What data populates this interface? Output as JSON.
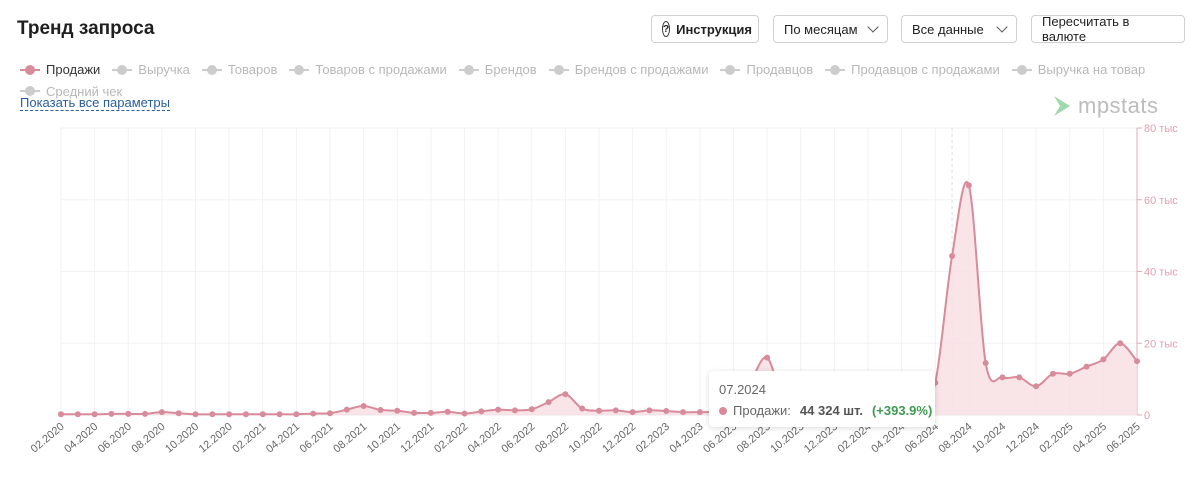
{
  "header": {
    "title": "Тренд запроса",
    "instruction_label": "Инструкция",
    "period_select": "По месяцам",
    "data_select": "Все данные",
    "currency_button": "Пересчитать в валюте"
  },
  "legend": {
    "items": [
      {
        "label": "Продажи",
        "active": true
      },
      {
        "label": "Выручка",
        "active": false
      },
      {
        "label": "Товаров",
        "active": false
      },
      {
        "label": "Товаров с продажами",
        "active": false
      },
      {
        "label": "Брендов",
        "active": false
      },
      {
        "label": "Брендов с продажами",
        "active": false
      },
      {
        "label": "Продавцов",
        "active": false
      },
      {
        "label": "Продавцов с продажами",
        "active": false
      },
      {
        "label": "Выручка на товар",
        "active": false
      },
      {
        "label": "Средний чек",
        "active": false
      }
    ],
    "show_all": "Показать все параметры"
  },
  "logo": "mpstats",
  "tooltip": {
    "date": "07.2024",
    "series": "Продажи:",
    "value": "44 324 шт.",
    "change": "(+393.9%)"
  },
  "colors": {
    "series": "#d88b9a",
    "fill": "#f8dfe4",
    "positive": "#3d9a50",
    "link": "#2a5d9b"
  },
  "chart_data": {
    "type": "area",
    "title": "Тренд запроса",
    "series": [
      {
        "name": "Продажи",
        "unit": "шт.",
        "values": [
          200,
          200,
          200,
          300,
          300,
          300,
          800,
          500,
          200,
          200,
          200,
          200,
          200,
          200,
          200,
          400,
          500,
          1500,
          2500,
          1400,
          1200,
          600,
          600,
          900,
          400,
          1000,
          1500,
          1300,
          1600,
          3600,
          5800,
          1800,
          1200,
          1300,
          800,
          1300,
          1100,
          800,
          800,
          900,
          1500,
          9000,
          16000,
          3000,
          1500,
          1200,
          1000,
          1000,
          1000,
          1000,
          1200,
          2500,
          8974,
          44324,
          64000,
          14500,
          10500,
          10500,
          8000,
          11500,
          11500,
          13500,
          15500,
          20000,
          15000
        ]
      }
    ],
    "x": [
      "02.2020",
      "03.2020",
      "04.2020",
      "05.2020",
      "06.2020",
      "07.2020",
      "08.2020",
      "09.2020",
      "10.2020",
      "11.2020",
      "12.2020",
      "01.2021",
      "02.2021",
      "03.2021",
      "04.2021",
      "05.2021",
      "06.2021",
      "07.2021",
      "08.2021",
      "09.2021",
      "10.2021",
      "11.2021",
      "12.2021",
      "01.2022",
      "02.2022",
      "03.2022",
      "04.2022",
      "05.2022",
      "06.2022",
      "07.2022",
      "08.2022",
      "09.2022",
      "10.2022",
      "11.2022",
      "12.2022",
      "01.2023",
      "02.2023",
      "03.2023",
      "04.2023",
      "05.2023",
      "06.2023",
      "07.2023",
      "08.2023",
      "09.2023",
      "10.2023",
      "11.2023",
      "12.2023",
      "01.2024",
      "02.2024",
      "03.2024",
      "04.2024",
      "05.2024",
      "06.2024",
      "07.2024",
      "08.2024",
      "09.2024",
      "10.2024",
      "11.2024",
      "12.2024",
      "01.2025",
      "02.2025",
      "03.2025",
      "04.2025",
      "05.2025",
      "06.2025"
    ],
    "ylim": [
      0,
      80000
    ],
    "yticks": [
      {
        "v": 0,
        "label": "0"
      },
      {
        "v": 20000,
        "label": "20 тыс"
      },
      {
        "v": 40000,
        "label": "40 тыс"
      },
      {
        "v": 60000,
        "label": "60 тыс"
      },
      {
        "v": 80000,
        "label": "80 тыс"
      }
    ],
    "y_axis_position": "right",
    "xlabel_every": 2,
    "highlight": "07.2024",
    "grid": true
  }
}
